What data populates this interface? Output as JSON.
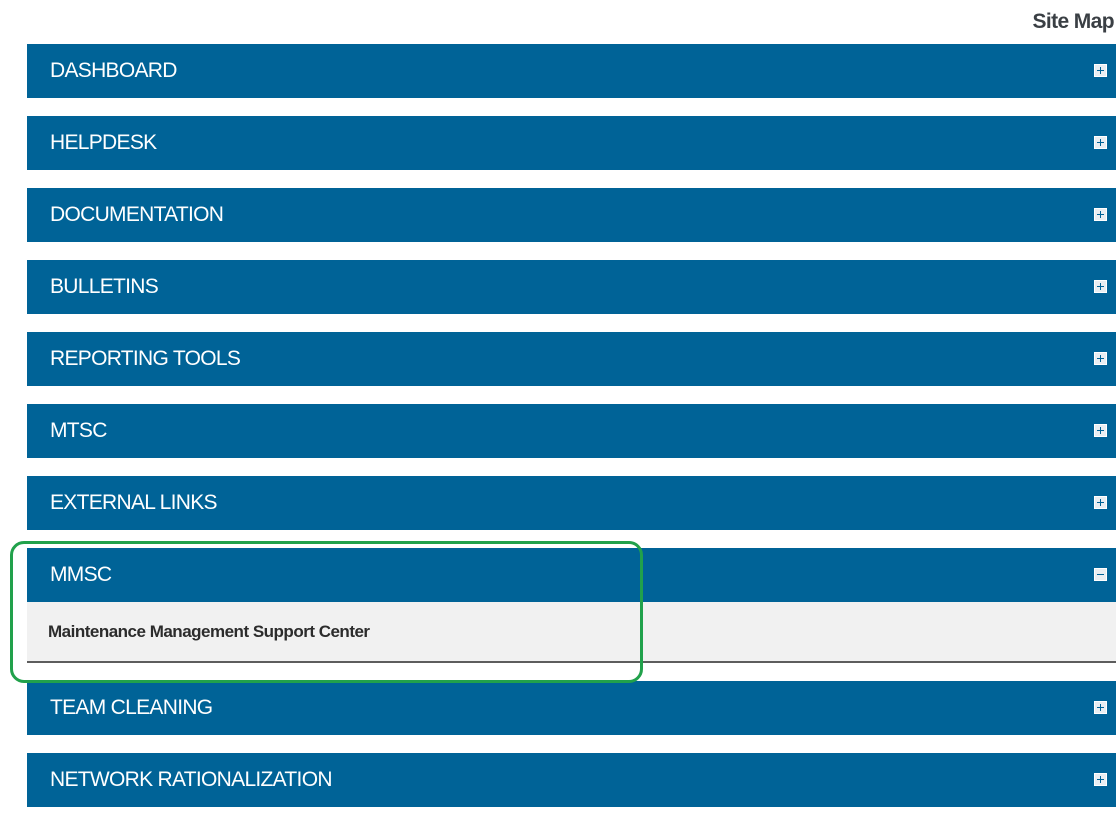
{
  "page": {
    "title": "Site Map"
  },
  "sections": [
    {
      "label": "DASHBOARD",
      "expanded": false
    },
    {
      "label": "HELPDESK",
      "expanded": false
    },
    {
      "label": "DOCUMENTATION",
      "expanded": false
    },
    {
      "label": "BULLETINS",
      "expanded": false
    },
    {
      "label": "REPORTING TOOLS",
      "expanded": false
    },
    {
      "label": "MTSC",
      "expanded": false
    },
    {
      "label": "EXTERNAL LINKS",
      "expanded": false
    },
    {
      "label": "MMSC",
      "expanded": true,
      "items": [
        {
          "label": "Maintenance Management Support Center"
        }
      ]
    },
    {
      "label": "TEAM CLEANING",
      "expanded": false
    },
    {
      "label": "NETWORK RATIONALIZATION",
      "expanded": false
    }
  ],
  "colors": {
    "header_bg": "#006397",
    "highlight": "#21a14b",
    "sub_bg": "#f1f1f1"
  },
  "icons": {
    "collapsed": "expand-plus-icon",
    "expanded": "collapse-minus-icon"
  }
}
